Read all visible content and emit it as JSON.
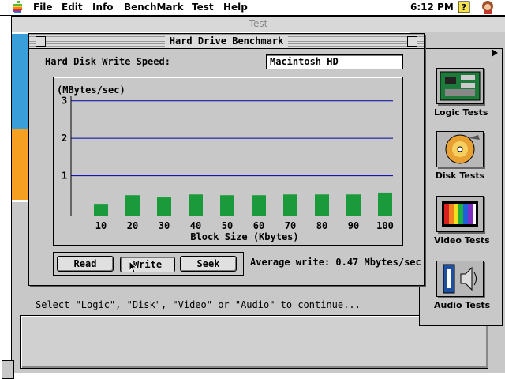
{
  "menubar": {
    "items": [
      "File",
      "Edit",
      "Info",
      "BenchMark",
      "Test",
      "Help"
    ],
    "clock": "6:12 PM"
  },
  "test_window": {
    "title": "Test",
    "instruction": "Select \"Logic\", \"Disk\", \"Video\" or \"Audio\" to continue..."
  },
  "tools": [
    {
      "label": "Logic Tests",
      "icon": "logic-board-icon"
    },
    {
      "label": "Disk Tests",
      "icon": "disk-icon"
    },
    {
      "label": "Video Tests",
      "icon": "video-icon"
    },
    {
      "label": "Audio Tests",
      "icon": "audio-icon"
    }
  ],
  "dialog": {
    "title": "Hard Drive Benchmark",
    "speed_label": "Hard Disk Write Speed:",
    "drive_name": "Macintosh HD",
    "buttons": {
      "read": "Read",
      "write": "Write",
      "seek": "Seek"
    },
    "average_text": "Average write: 0.47 Mbytes/sec"
  },
  "chart_data": {
    "type": "bar",
    "ylabel": "(MBytes/sec)",
    "xlabel": "Block Size (Kbytes)",
    "categories": [
      "10",
      "20",
      "30",
      "40",
      "50",
      "60",
      "70",
      "80",
      "90",
      "100"
    ],
    "values": [
      0.25,
      0.48,
      0.42,
      0.5,
      0.48,
      0.48,
      0.5,
      0.5,
      0.5,
      0.55
    ],
    "yticks": [
      1,
      2,
      3
    ],
    "ylim": [
      0,
      3.5
    ],
    "grid": true,
    "colors": {
      "bar": "#1a9a3a",
      "gridline": "#0000a0"
    }
  }
}
